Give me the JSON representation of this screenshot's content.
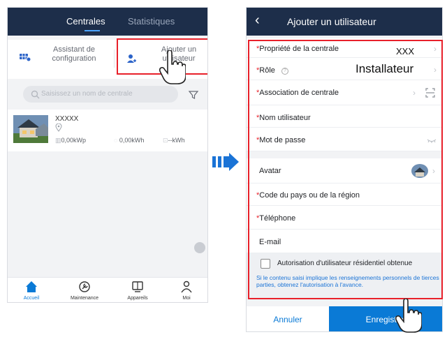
{
  "left": {
    "tabs": [
      {
        "label": "Centrales",
        "active": true
      },
      {
        "label": "Statistiques",
        "active": false
      }
    ],
    "actions": {
      "wizard": {
        "line1": "Assistant de",
        "line2": "configuration"
      },
      "add_user": {
        "line1": "Ajouter un",
        "line2": "utilisateur"
      }
    },
    "search": {
      "placeholder": "Saisissez un nom de centrale"
    },
    "plant": {
      "name": "XXXXX",
      "capacity": "0,00kWp",
      "energy": "0,00kWh",
      "yield": "--kWh"
    },
    "nav": [
      {
        "label": "Accueil",
        "icon": "home-icon",
        "active": true
      },
      {
        "label": "Maintenance",
        "icon": "maintenance-icon",
        "active": false
      },
      {
        "label": "Appareils",
        "icon": "devices-icon",
        "active": false
      },
      {
        "label": "Moi",
        "icon": "user-icon",
        "active": false
      }
    ]
  },
  "right": {
    "title": "Ajouter un utilisateur",
    "fields": {
      "plant_owner": {
        "required": "*",
        "label": "Propriété de la centrale",
        "value": "XXX"
      },
      "role": {
        "required": "*",
        "label": "Rôle",
        "value": "Installateur"
      },
      "plant_association": {
        "required": "*",
        "label": "Association de centrale"
      },
      "username": {
        "required": "*",
        "label": "Nom utilisateur"
      },
      "password": {
        "required": "*",
        "label": "Mot de passe"
      },
      "avatar": {
        "label": "Avatar"
      },
      "country_code": {
        "required": "*",
        "label": "Code du pays ou de la région"
      },
      "phone": {
        "required": "*",
        "label": "Téléphone"
      },
      "email": {
        "label": "E-mail"
      }
    },
    "consent": {
      "label": "Autorisation d'utilisateur résidentiel obtenue",
      "notice": "Si le contenu saisi implique les renseignements personnels de tierces parties, obtenez l'autorisation à l'avance."
    },
    "buttons": {
      "cancel": "Annuler",
      "save": "Enregistrer"
    }
  },
  "colors": {
    "header": "#1d2e4a",
    "accent": "#0a7ad6",
    "highlight": "#e8202a"
  }
}
